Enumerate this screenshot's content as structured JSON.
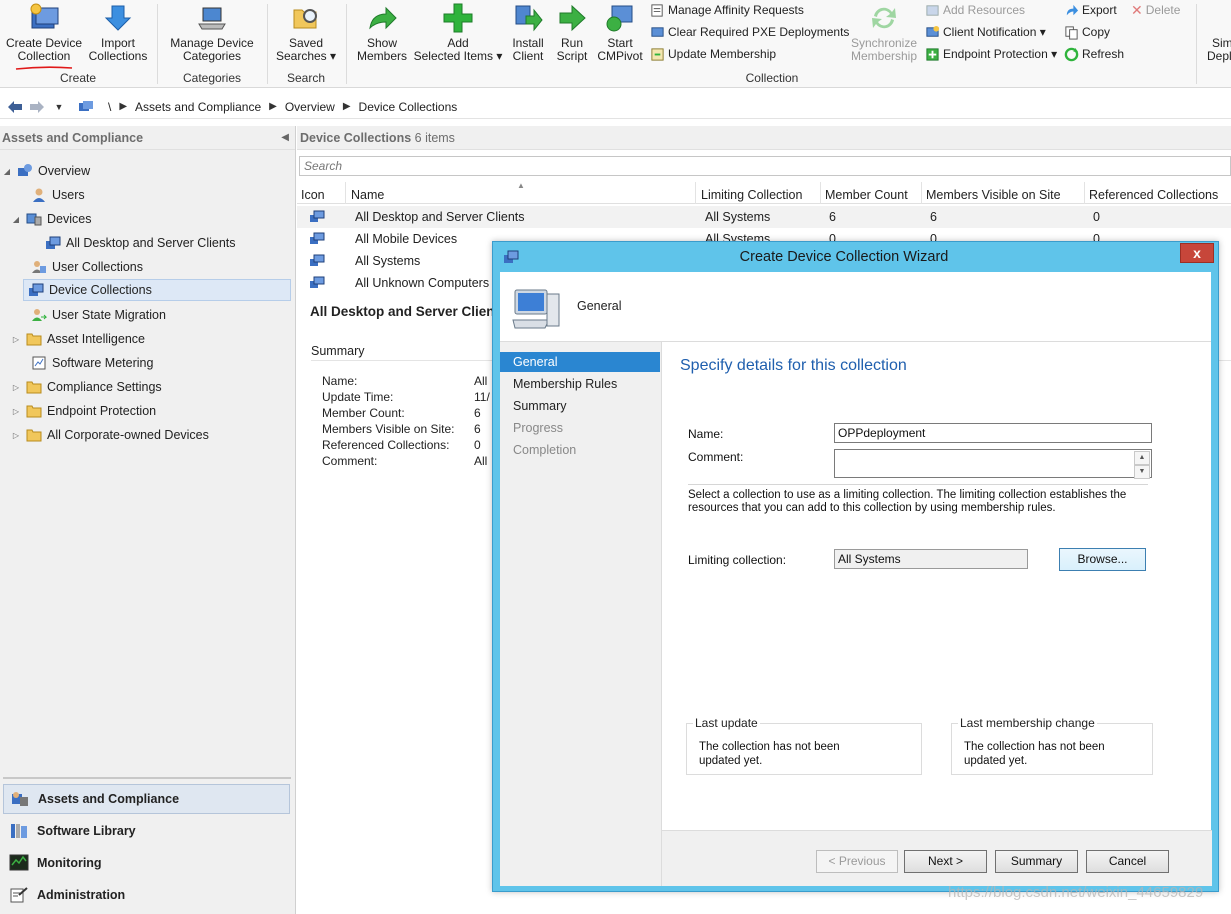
{
  "ribbon": {
    "create_device_collection": "Create Device\nCollection",
    "create_line1": "Create Device",
    "create_line2": "Collection",
    "import_line1": "Import",
    "import_line2": "Collections",
    "group_create": "Create",
    "manage_line1": "Manage Device",
    "manage_line2": "Categories",
    "group_categories": "Categories",
    "saved_line1": "Saved",
    "saved_line2": "Searches ▾",
    "group_search": "Search",
    "show_line1": "Show",
    "show_line2": "Members",
    "add_line1": "Add",
    "add_line2": "Selected Items ▾",
    "install_line1": "Install",
    "install_line2": "Client",
    "run_line1": "Run",
    "run_line2": "Script",
    "start_line1": "Start",
    "start_line2": "CMPivot",
    "manage_affinity": "Manage Affinity Requests",
    "clear_pxe": "Clear Required PXE Deployments",
    "update_membership": "Update Membership",
    "group_collection": "Collection",
    "sync_line1": "Synchronize",
    "sync_line2": "Membership",
    "add_resources": "Add Resources",
    "client_notification": "Client Notification ▾",
    "endpoint_protection": "Endpoint Protection ▾",
    "export": "Export",
    "copy": "Copy",
    "refresh": "Refresh",
    "delete": "Delete",
    "sim_line1": "Sim",
    "sim_line2": "Depl"
  },
  "address": {
    "root": "\\",
    "crumbs": [
      "Assets and Compliance",
      "Overview",
      "Device Collections"
    ]
  },
  "left": {
    "header": "Assets and Compliance",
    "tree": [
      {
        "label": "Overview"
      },
      {
        "label": "Users"
      },
      {
        "label": "Devices"
      },
      {
        "label": "All Desktop and Server Clients"
      },
      {
        "label": "User Collections"
      },
      {
        "label": "Device Collections"
      },
      {
        "label": "User State Migration"
      },
      {
        "label": "Asset Intelligence"
      },
      {
        "label": "Software Metering"
      },
      {
        "label": "Compliance Settings"
      },
      {
        "label": "Endpoint Protection"
      },
      {
        "label": "All Corporate-owned Devices"
      }
    ],
    "workspaces": [
      "Assets and Compliance",
      "Software Library",
      "Monitoring",
      "Administration"
    ]
  },
  "content": {
    "header_title": "Device Collections",
    "header_count": "6 items",
    "search_placeholder": "Search",
    "columns": [
      "Icon",
      "Name",
      "Limiting Collection",
      "Member Count",
      "Members Visible on Site",
      "Referenced Collections"
    ],
    "rows": [
      {
        "name": "All Desktop and Server Clients",
        "limiting": "All Systems",
        "count": "6",
        "visible": "6",
        "referenced": "0"
      },
      {
        "name": "All Mobile Devices",
        "limiting": "All Systems",
        "count": "0",
        "visible": "0",
        "referenced": "0"
      },
      {
        "name": "All Systems",
        "limiting": "",
        "count": "",
        "visible": "",
        "referenced": ""
      },
      {
        "name": "All Unknown Computers",
        "limiting": "",
        "count": "",
        "visible": "",
        "referenced": ""
      }
    ],
    "detail_title": "All Desktop and Server Clients",
    "detail_summary": "Summary",
    "detail_labels": [
      "Name:",
      "Update Time:",
      "Member Count:",
      "Members Visible on Site:",
      "Referenced Collections:",
      "Comment:"
    ],
    "detail_values": [
      "All",
      "11/",
      "6",
      "6",
      "0",
      "All"
    ]
  },
  "wizard": {
    "title": "Create Device Collection Wizard",
    "banner": "General",
    "steps": [
      "General",
      "Membership Rules",
      "Summary",
      "Progress",
      "Completion"
    ],
    "heading": "Specify details for this collection",
    "name_label": "Name:",
    "name_value": "OPPdeployment",
    "comment_label": "Comment:",
    "comment_value": "",
    "info": "Select a collection to use as a limiting collection. The limiting collection establishes the resources that you can add to this collection by using membership rules.",
    "limiting_label": "Limiting collection:",
    "limiting_value": "All Systems",
    "browse": "Browse...",
    "last_update_title": "Last update",
    "last_update_text": "The collection has not been updated yet.",
    "last_change_title": "Last membership change",
    "last_change_text": "The collection has not been updated yet.",
    "btn_previous": "< Previous",
    "btn_next": "Next >",
    "btn_summary": "Summary",
    "btn_cancel": "Cancel",
    "close": "x"
  },
  "watermark": "https://blog.csdn.net/weixin_44659829"
}
